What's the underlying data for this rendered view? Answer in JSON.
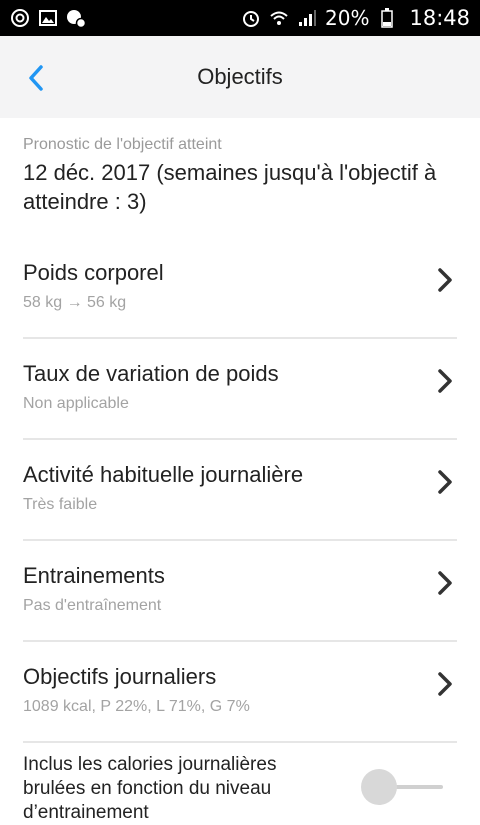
{
  "status_bar": {
    "battery_text": "20%",
    "time": "18:48"
  },
  "header": {
    "title": "Objectifs",
    "accent_color": "#2196f3"
  },
  "forecast": {
    "label": "Pronostic de l'objectif atteint",
    "value": "12 déc. 2017 (semaines jusqu'à l'objectif à atteindre : 3)"
  },
  "settings": [
    {
      "title": "Poids corporel",
      "subtitle": "58 kg → 56 kg"
    },
    {
      "title": "Taux de variation de poids",
      "subtitle": "Non applicable"
    },
    {
      "title": "Activité habituelle journalière",
      "subtitle": "Très faible"
    },
    {
      "title": "Entrainements",
      "subtitle": "Pas d'entraînement"
    },
    {
      "title": "Objectifs journaliers",
      "subtitle": "1089 kcal, P 22%, L 71%, G 7%"
    }
  ],
  "toggle": {
    "label": "Inclus les calories journalières brulées en fonction du niveau d’entrainement",
    "state": "off"
  }
}
